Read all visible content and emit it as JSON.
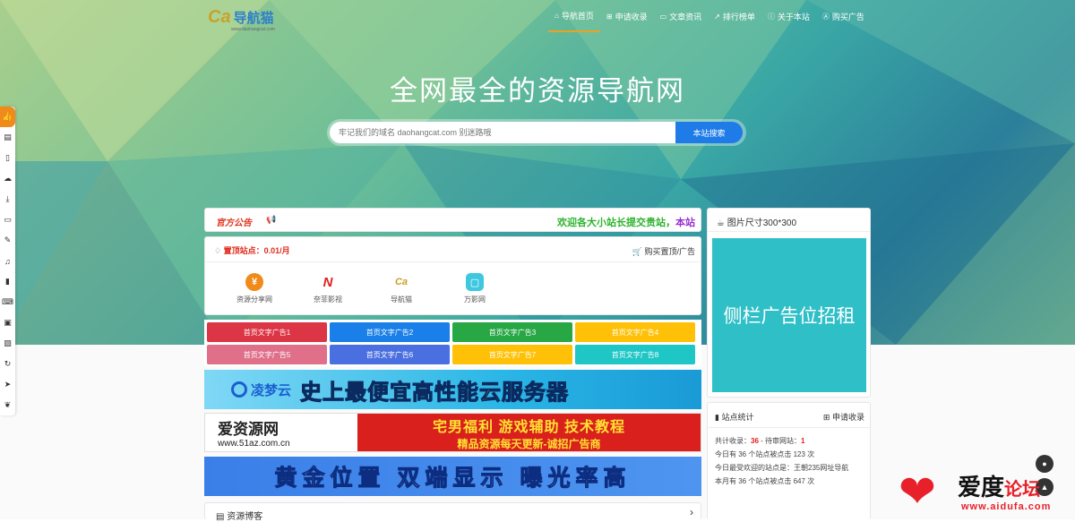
{
  "logo": {
    "text": "导航猫",
    "sub": "www.daohangcat.com"
  },
  "nav": [
    {
      "icon": "home-icon",
      "glyph": "⌂",
      "label": "导航首页"
    },
    {
      "icon": "plus-square-icon",
      "glyph": "⊞",
      "label": "申请收录"
    },
    {
      "icon": "folder-icon",
      "glyph": "▭",
      "label": "文章资讯"
    },
    {
      "icon": "chart-icon",
      "glyph": "↗",
      "label": "排行榜单"
    },
    {
      "icon": "info-icon",
      "glyph": "ⓘ",
      "label": "关于本站"
    },
    {
      "icon": "ad-icon",
      "glyph": "Ⓐ",
      "label": "购买广告"
    }
  ],
  "hero": {
    "title": "全网最全的资源导航网"
  },
  "search": {
    "placeholder": "牢记我们的域名 daohangcat.com 别迷路哦",
    "button": "本站搜索"
  },
  "sidebar_tools": [
    "thumb-up-icon",
    "book-icon",
    "file-icon",
    "cloud-icon",
    "download-icon",
    "monitor-icon",
    "edit-icon",
    "music-icon",
    "mobile-icon",
    "keyboard-icon",
    "briefcase-icon",
    "image-icon",
    "refresh-icon",
    "send-icon",
    "leaf-icon"
  ],
  "notice": {
    "tag": "官方公告",
    "text_a": "欢迎各大小站长提交贵站，",
    "text_b": "本站"
  },
  "pinned": {
    "title": "置顶站点：0.01/月",
    "buy": "购买置顶/广告",
    "sites": [
      {
        "name": "资源分享网",
        "glyph": "¥",
        "color": "#f08a1a"
      },
      {
        "name": "奈菲影视",
        "glyph": "N",
        "color": "#ffffff"
      },
      {
        "name": "导航猫",
        "glyph": "Ca",
        "color": "#ffffff"
      },
      {
        "name": "万影网",
        "glyph": "▢",
        "color": "#3ec8e0"
      }
    ]
  },
  "text_ads": [
    {
      "label": "首页文字广告1",
      "color": "#dc3545"
    },
    {
      "label": "首页文字广告2",
      "color": "#1a7fe8"
    },
    {
      "label": "首页文字广告3",
      "color": "#28a745"
    },
    {
      "label": "首页文字广告4",
      "color": "#ffc107"
    },
    {
      "label": "首页文字广告5",
      "color": "#e0708a"
    },
    {
      "label": "首页文字广告6",
      "color": "#4a6fe0"
    },
    {
      "label": "首页文字广告7",
      "color": "#ffc107"
    },
    {
      "label": "首页文字广告8",
      "color": "#1ec6c6"
    }
  ],
  "banner1": {
    "brand": "凌梦云",
    "text": "史上最便宜高性能云服务器"
  },
  "banner2": {
    "name": "爱资源网",
    "url": "www.51az.com.cn",
    "line1": "宅男福利 游戏辅助 技术教程",
    "line2": "精品资源每天更新-诚招广告商"
  },
  "banner3": {
    "text": "黄金位置 双端显示 曝光率高"
  },
  "blog": {
    "title": "资源博客"
  },
  "right_ad": {
    "title": "图片尺寸300*300",
    "text": "侧栏广告位招租"
  },
  "stats": {
    "title": "站点统计",
    "apply": "申请收录",
    "included_label": "共计收录：",
    "included": "36",
    "sep": " - ",
    "pending_label": "待审网站：",
    "pending": "1",
    "lines": [
      "今日有 36 个站点被点击 123 次",
      "今日最受欢迎的站点是：王朝235网址导航",
      "本月有 36 个站点被点击 647 次"
    ]
  },
  "watermark": {
    "title_a": "爱度",
    "title_b": "论坛",
    "url": "www.aidufa.com"
  }
}
